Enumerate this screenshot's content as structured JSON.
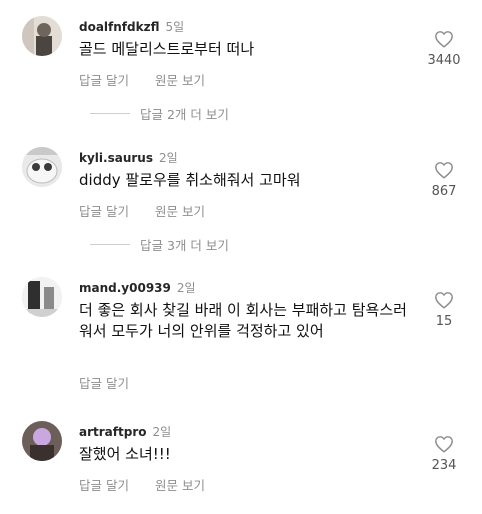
{
  "comments": [
    {
      "username": "doalfnfdkzfl",
      "time": "5일",
      "text": "골드 메달리스트로부터 떠나",
      "reply_label": "답글 달기",
      "original_label": "원문 보기",
      "likes": "3440",
      "more_replies": "답글 2개 더 보기"
    },
    {
      "username": "kyli.saurus",
      "time": "2일",
      "text": "diddy 팔로우를 취소해줘서 고마워",
      "reply_label": "답글 달기",
      "original_label": "원문 보기",
      "likes": "867",
      "more_replies": "답글 3개 더 보기"
    },
    {
      "username": "mand.y00939",
      "time": "2일",
      "text": "더 좋은 회사 찾길 바래 이 회사는 부패하고 탐욕스러워서 모두가 너의 안위를 걱정하고 있어",
      "reply_label": "답글 달기",
      "likes": "15"
    },
    {
      "username": "artraftpro",
      "time": "2일",
      "text": "잘했어 소녀!!!",
      "reply_label": "답글 달기",
      "original_label": "원문 보기",
      "likes": "234"
    }
  ],
  "icons": {
    "like": "heart-outline-icon"
  },
  "colors": {
    "muted": "#8e8e8e",
    "text": "#111111"
  }
}
